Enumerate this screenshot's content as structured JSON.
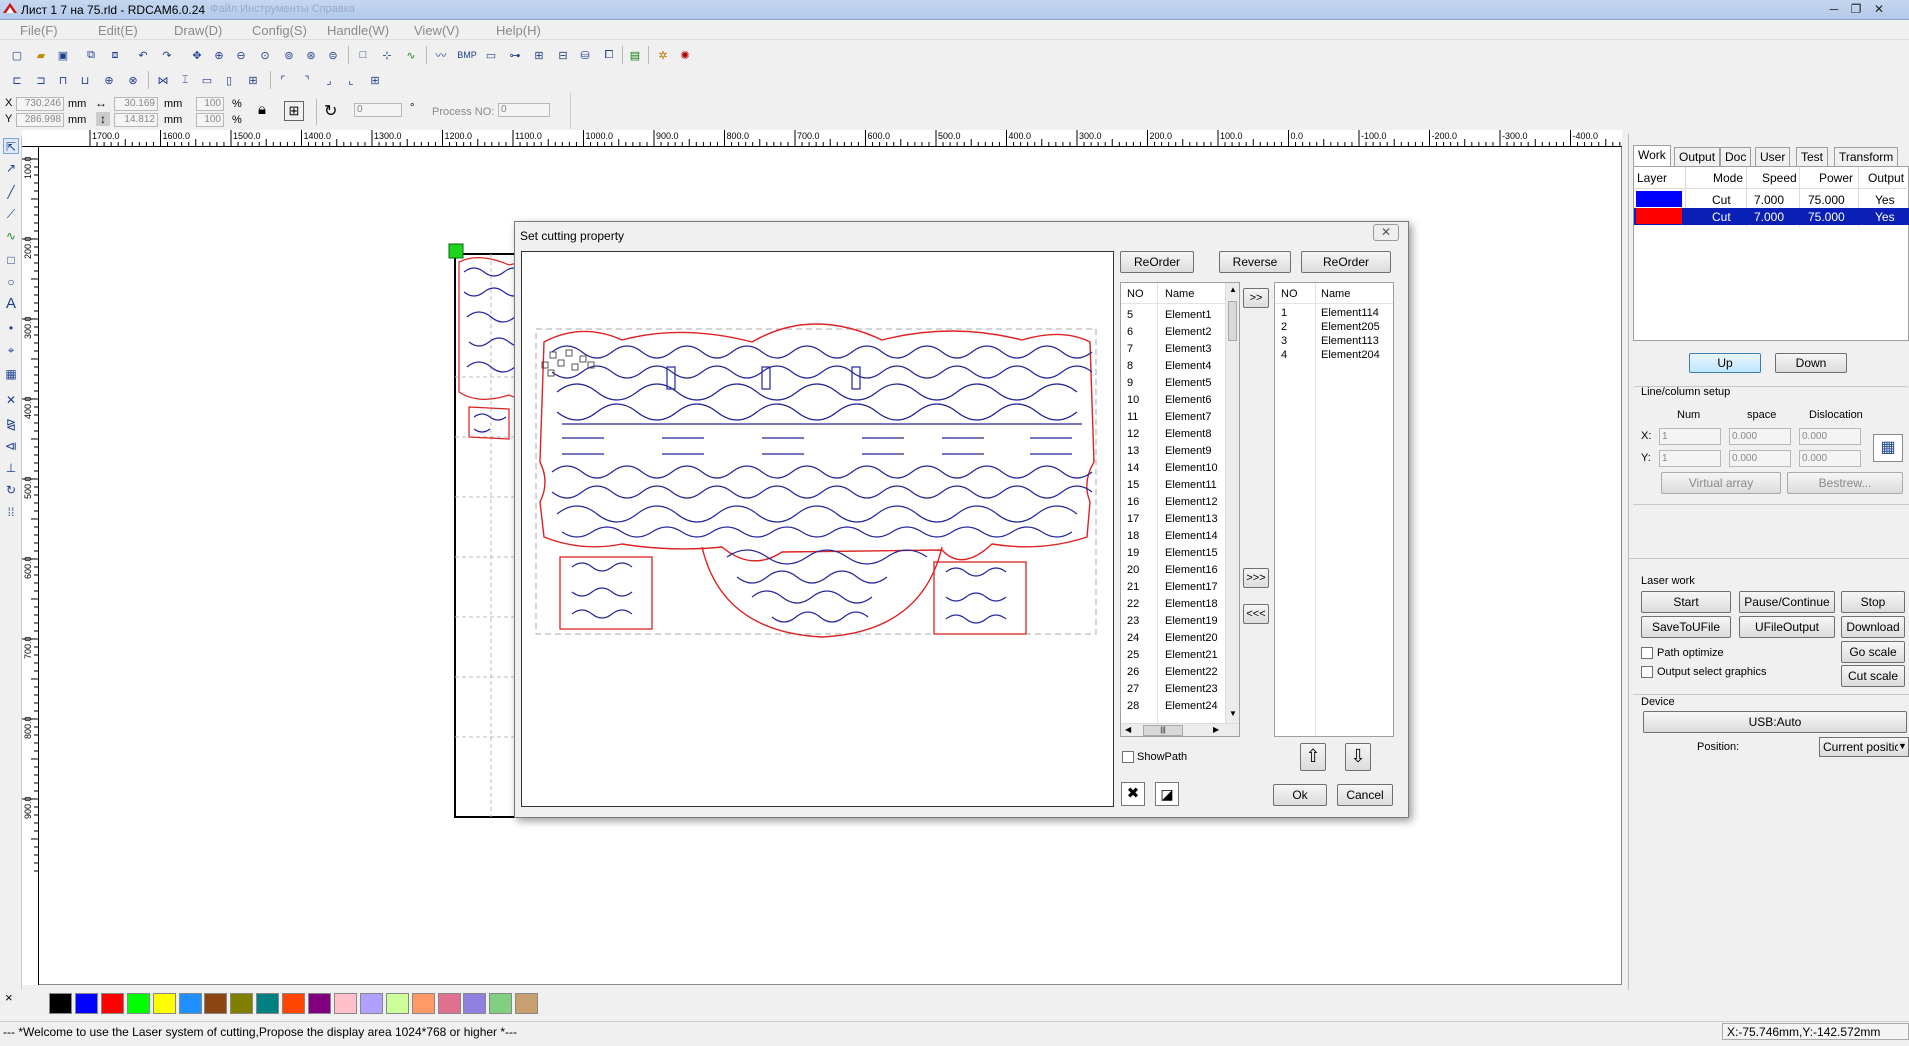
{
  "window": {
    "title": "Лист 1 7 на 75.rld - RDCAM6.0.24",
    "title_dim": "Файл   Инструменты   Справка",
    "minimize": "─",
    "restore": "❐",
    "close": "✕"
  },
  "menu": [
    "File(F)",
    "Edit(E)",
    "Draw(D)",
    "Config(S)",
    "Handle(W)",
    "View(V)",
    "Help(H)"
  ],
  "toolbar": {
    "bmp_label": "BMP"
  },
  "coords": {
    "x_label": "X",
    "y_label": "Y",
    "x_value": "730.246",
    "y_value": "286.998",
    "unit": "mm",
    "width_value": "30.169",
    "height_value": "14.812",
    "pct_x": "100",
    "pct_y": "100",
    "pct": "%",
    "rotate_value": "0",
    "degree": "°",
    "process_label": "Process NO:",
    "process_value": "0"
  },
  "ruler": {
    "h_ticks": [
      "1700.0",
      "1600.0",
      "1500.0",
      "1400.0",
      "1300.0",
      "1200.0",
      "1100.0",
      "1000.0",
      "900.0",
      "800.0",
      "700.0",
      "600.0",
      "500.0",
      "400.0",
      "300.0",
      "200.0",
      "100.0",
      "0.0",
      "-100.0",
      "-200.0",
      "-300.0",
      "-400.0"
    ],
    "v_ticks": [
      "100.0",
      "200.0",
      "300.0",
      "400.0",
      "500.0",
      "600.0",
      "700.0",
      "800.0",
      "900.0"
    ]
  },
  "palette": {
    "colors": [
      "#000000",
      "#0000ff",
      "#ff0000",
      "#00ff00",
      "#ffff00",
      "#1e90ff",
      "#8b4513",
      "#808000",
      "#008080",
      "#ff4500",
      "#800080",
      "#ffc0cb",
      "#b0a0ff",
      "#ccff99",
      "#ff9966",
      "#e07090",
      "#9080e0",
      "#80d080",
      "#c8a070"
    ],
    "close_x": "×"
  },
  "status": {
    "message": "--- *Welcome to use the Laser system of cutting,Propose the display area 1024*768 or higher *---",
    "position": "X:-75.746mm,Y:-142.572mm"
  },
  "right_panel": {
    "tabs": [
      "Work",
      "Output",
      "Doc",
      "User",
      "Test",
      "Transform"
    ],
    "layer_headers": [
      "Layer",
      "Mode",
      "Speed",
      "Power",
      "Output"
    ],
    "layers": [
      {
        "color": "#0000ff",
        "mode": "Cut",
        "speed": "7.000",
        "power": "75.000",
        "output": "Yes"
      },
      {
        "color": "#ff0000",
        "mode": "Cut",
        "speed": "7.000",
        "power": "75.000",
        "output": "Yes"
      }
    ],
    "up": "Up",
    "down": "Down",
    "line_setup": {
      "title": "Line/column setup",
      "headers": [
        "Num",
        "space",
        "Dislocation"
      ],
      "x_label": "X:",
      "y_label": "Y:",
      "x_num": "1",
      "x_space": "0.000",
      "x_disloc": "0.000",
      "y_num": "1",
      "y_space": "0.000",
      "y_disloc": "0.000",
      "virtual_array": "Virtual array",
      "bestrew": "Bestrew..."
    },
    "laser_work": {
      "title": "Laser work",
      "start": "Start",
      "pause": "Pause/Continue",
      "stop": "Stop",
      "save_u": "SaveToUFile",
      "ufile_out": "UFileOutput",
      "download": "Download",
      "path_optimize": "Path optimize",
      "output_select": "Output select graphics",
      "go_scale": "Go scale",
      "cut_scale": "Cut scale"
    },
    "device": {
      "title": "Device",
      "usb": "USB:Auto",
      "position_label": "Position:",
      "position_value": "Current positic"
    }
  },
  "dialog": {
    "title": "Set cutting property",
    "close": "✕",
    "reorder_left": "ReOrder",
    "reverse": "Reverse",
    "reorder_right": "ReOrder",
    "col_no": "NO",
    "col_name": "Name",
    "left_list": [
      {
        "no": "5",
        "name": "Element1"
      },
      {
        "no": "6",
        "name": "Element2"
      },
      {
        "no": "7",
        "name": "Element3"
      },
      {
        "no": "8",
        "name": "Element4"
      },
      {
        "no": "9",
        "name": "Element5"
      },
      {
        "no": "10",
        "name": "Element6"
      },
      {
        "no": "11",
        "name": "Element7"
      },
      {
        "no": "12",
        "name": "Element8"
      },
      {
        "no": "13",
        "name": "Element9"
      },
      {
        "no": "14",
        "name": "Element10"
      },
      {
        "no": "15",
        "name": "Element11"
      },
      {
        "no": "16",
        "name": "Element12"
      },
      {
        "no": "17",
        "name": "Element13"
      },
      {
        "no": "18",
        "name": "Element14"
      },
      {
        "no": "19",
        "name": "Element15"
      },
      {
        "no": "20",
        "name": "Element16"
      },
      {
        "no": "21",
        "name": "Element17"
      },
      {
        "no": "22",
        "name": "Element18"
      },
      {
        "no": "23",
        "name": "Element19"
      },
      {
        "no": "24",
        "name": "Element20"
      },
      {
        "no": "25",
        "name": "Element21"
      },
      {
        "no": "26",
        "name": "Element22"
      },
      {
        "no": "27",
        "name": "Element23"
      },
      {
        "no": "28",
        "name": "Element24"
      }
    ],
    "right_list": [
      {
        "no": "1",
        "name": "Element114"
      },
      {
        "no": "2",
        "name": "Element205"
      },
      {
        "no": "3",
        "name": "Element113"
      },
      {
        "no": "4",
        "name": "Element204"
      }
    ],
    "move_right": ">>",
    "move_all_right": ">>>",
    "move_all_left": "<<<",
    "show_path": "ShowPath",
    "up_arrow": "⇧",
    "down_arrow": "⇩",
    "ok": "Ok",
    "cancel": "Cancel",
    "hscroll_grip": "|||"
  }
}
